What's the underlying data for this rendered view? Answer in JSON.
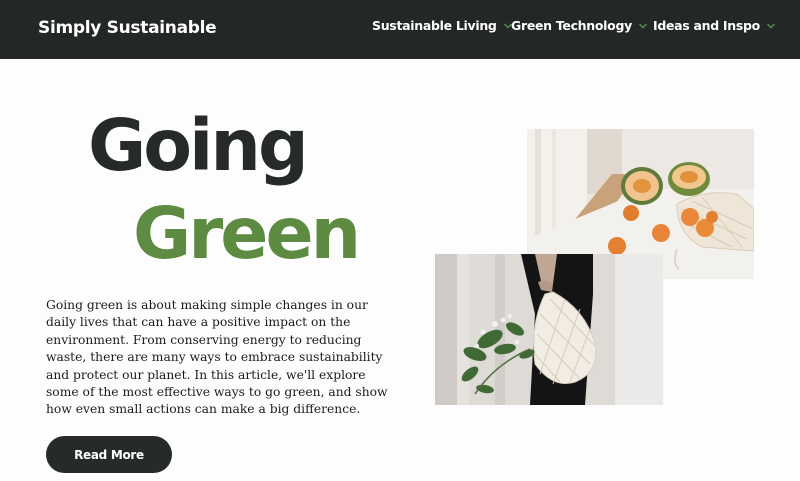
{
  "header": {
    "brand": "Simply Sustainable",
    "nav": [
      {
        "label": "Sustainable Living",
        "icon": "chevron-down-icon"
      },
      {
        "label": "Green Technology",
        "icon": "chevron-down-icon"
      },
      {
        "label": "Ideas and Inspo",
        "icon": "chevron-down-icon"
      }
    ]
  },
  "hero": {
    "title_line1": "Going",
    "title_line2": "Green",
    "intro": "Going green is about making simple changes in our daily lives that can have a positive impact on the environment. From conserving energy to reducing waste, there are many ways to embrace sustainability and protect our planet. In this article, we'll explore some of the most effective ways to go green, and show how even small actions can make a big difference.",
    "cta_label": "Read More"
  },
  "colors": {
    "nav_bg": "#232826",
    "accent_green": "#5d8b41",
    "headline_dark": "#262a28"
  }
}
